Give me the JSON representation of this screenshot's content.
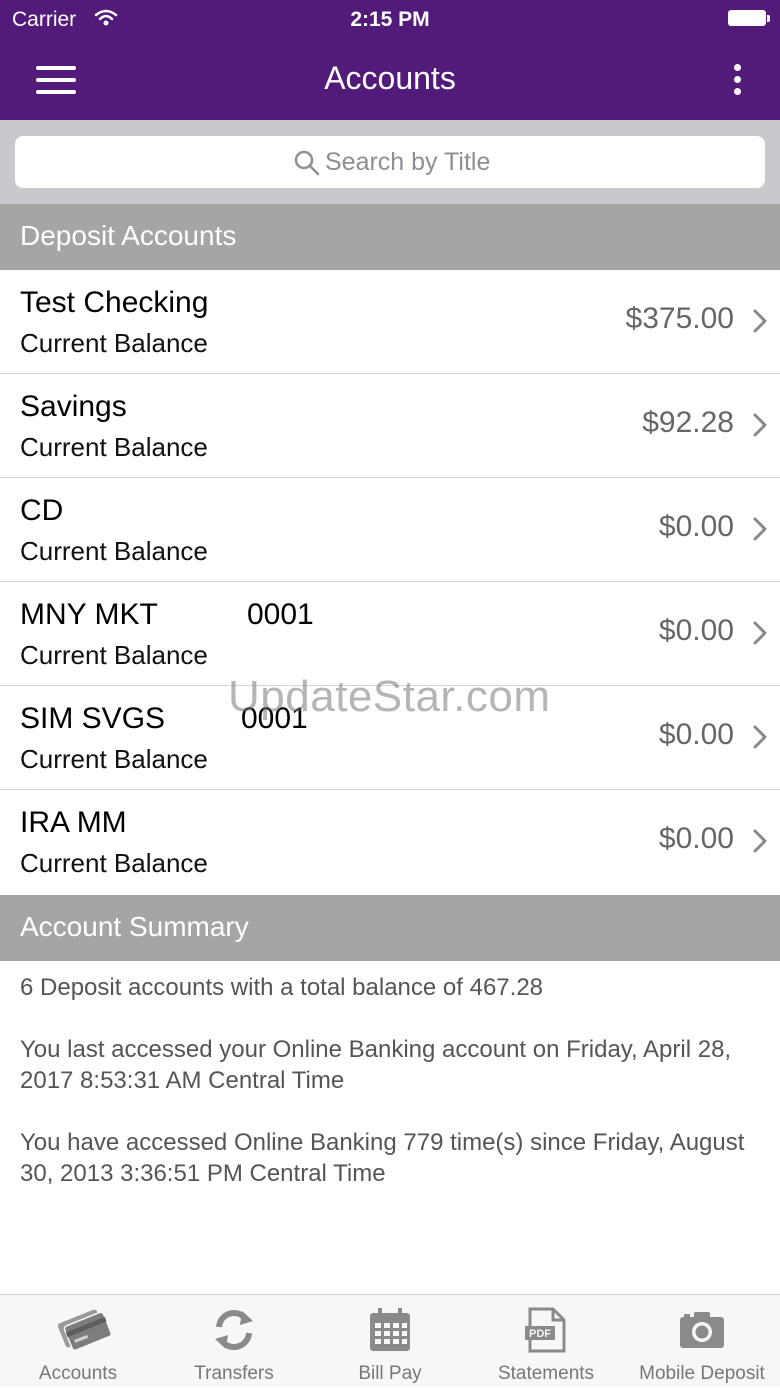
{
  "status_bar": {
    "carrier": "Carrier",
    "time": "2:15 PM"
  },
  "nav": {
    "title": "Accounts"
  },
  "search": {
    "placeholder": "Search by Title"
  },
  "deposit_section": {
    "title": "Deposit Accounts",
    "accounts": [
      {
        "name": "Test Checking",
        "number": "",
        "balance_label": "Current Balance",
        "amount": "$375.00"
      },
      {
        "name": "Savings",
        "number": "",
        "balance_label": "Current Balance",
        "amount": "$92.28"
      },
      {
        "name": "CD",
        "number": "",
        "balance_label": "Current Balance",
        "amount": "$0.00"
      },
      {
        "name": "MNY MKT",
        "number": "0001",
        "balance_label": "Current Balance",
        "amount": "$0.00"
      },
      {
        "name": "SIM SVGS",
        "number": "0001",
        "balance_label": "Current Balance",
        "amount": "$0.00"
      },
      {
        "name": "IRA MM",
        "number": "",
        "balance_label": "Current Balance",
        "amount": "$0.00"
      }
    ]
  },
  "summary_section": {
    "title": "Account Summary",
    "total_text": "6 Deposit accounts with a total balance of 467.28",
    "last_access_text": "You last accessed your Online Banking account on Friday, April 28, 2017 8:53:31 AM Central Time",
    "access_count_text": "You have accessed Online Banking 779 time(s) since Friday, August 30, 2013 3:36:51 PM Central Time"
  },
  "watermark": "UpdateStar.com",
  "tab_bar": {
    "tabs": [
      {
        "label": "Accounts",
        "icon": "cards-icon"
      },
      {
        "label": "Transfers",
        "icon": "refresh-icon"
      },
      {
        "label": "Bill Pay",
        "icon": "calendar-icon"
      },
      {
        "label": "Statements",
        "icon": "pdf-icon"
      },
      {
        "label": "Mobile Deposit",
        "icon": "camera-icon"
      }
    ]
  },
  "colors": {
    "brand": "#521b7a",
    "section": "#a5a5a5",
    "search_bg": "#c9c8cd"
  }
}
